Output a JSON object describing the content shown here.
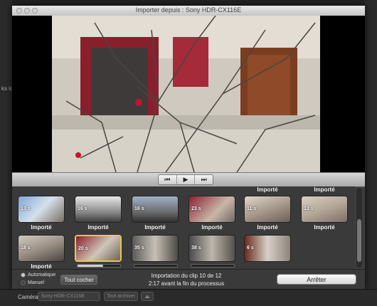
{
  "window": {
    "title": "Importer depuis : Sony HDR-CX116E"
  },
  "background": {
    "left_text": "ks lci"
  },
  "controls": {
    "prev_icon": "⏮",
    "play_icon": "▶",
    "next_icon": "⏭"
  },
  "clips": [
    {
      "duration": "13 s",
      "label": "Importé"
    },
    {
      "duration": "16 s",
      "label": "Importé"
    },
    {
      "duration": "16 s",
      "label": "Importé"
    },
    {
      "duration": "23 s",
      "label": "Importé"
    },
    {
      "duration": "11 s",
      "label": "Importé"
    },
    {
      "duration": "13 s",
      "label": "Importé"
    },
    {
      "duration": "18 s",
      "label": "Importé"
    },
    {
      "duration": "20 s",
      "label": "",
      "progress": 0.6
    },
    {
      "duration": "35 s",
      "label": "",
      "progress": 0
    },
    {
      "duration": "38 s",
      "label": "",
      "progress": 0
    },
    {
      "duration": "6 s",
      "label": ""
    }
  ],
  "top_labels": [
    "Importé",
    "Importé"
  ],
  "bottom": {
    "mode_auto": "Automatique",
    "mode_manual": "Manuel",
    "check_all": "Tout cocher",
    "status_line1": "Importation du clip 10 de 12",
    "status_line2": "2:17 avant la fin du processus",
    "stop": "Arrêter"
  },
  "footer": {
    "camera_label": "Caméra :",
    "camera_value": "Sony HDR-CX116E",
    "archive_button": "Tout archiver",
    "eject_icon": "⏏"
  }
}
